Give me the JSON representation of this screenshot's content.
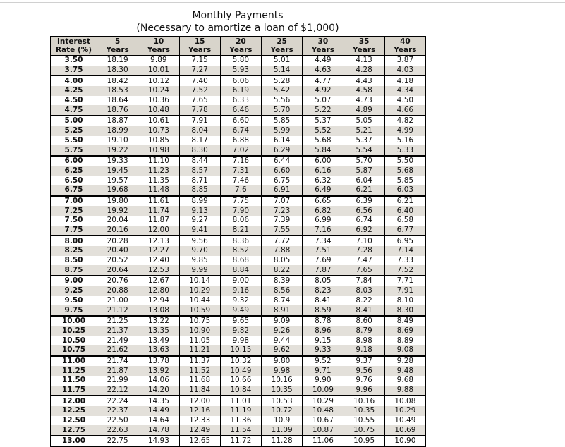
{
  "title": "Monthly Payments",
  "subtitle": "(Necessary to amortize a loan of $1,000)",
  "headers": [
    [
      "Interest",
      "Rate (%)"
    ],
    [
      "5",
      "Years"
    ],
    [
      "10",
      "Years"
    ],
    [
      "15",
      "Years"
    ],
    [
      "20",
      "Years"
    ],
    [
      "25",
      "Years"
    ],
    [
      "30",
      "Years"
    ],
    [
      "35",
      "Years"
    ],
    [
      "40",
      "Years"
    ]
  ],
  "rows": [
    [
      "3.50",
      "18.19",
      "9.89",
      "7.15",
      "5.80",
      "5.01",
      "4.49",
      "4.13",
      "3.87"
    ],
    [
      "3.75",
      "18.30",
      "10.01",
      "7.27",
      "5.93",
      "5.14",
      "4.63",
      "4.28",
      "4.03"
    ],
    [
      "4.00",
      "18.42",
      "10.12",
      "7.40",
      "6.06",
      "5.28",
      "4.77",
      "4.43",
      "4.18"
    ],
    [
      "4.25",
      "18.53",
      "10.24",
      "7.52",
      "6.19",
      "5.42",
      "4.92",
      "4.58",
      "4.34"
    ],
    [
      "4.50",
      "18.64",
      "10.36",
      "7.65",
      "6.33",
      "5.56",
      "5.07",
      "4.73",
      "4.50"
    ],
    [
      "4.75",
      "18.76",
      "10.48",
      "7.78",
      "6.46",
      "5.70",
      "5.22",
      "4.89",
      "4.66"
    ],
    [
      "5.00",
      "18.87",
      "10.61",
      "7.91",
      "6.60",
      "5.85",
      "5.37",
      "5.05",
      "4.82"
    ],
    [
      "5.25",
      "18.99",
      "10.73",
      "8.04",
      "6.74",
      "5.99",
      "5.52",
      "5.21",
      "4.99"
    ],
    [
      "5.50",
      "19.10",
      "10.85",
      "8.17",
      "6.88",
      "6.14",
      "5.68",
      "5.37",
      "5.16"
    ],
    [
      "5.75",
      "19.22",
      "10.98",
      "8.30",
      "7.02",
      "6.29",
      "5.84",
      "5.54",
      "5.33"
    ],
    [
      "6.00",
      "19.33",
      "11.10",
      "8.44",
      "7.16",
      "6.44",
      "6.00",
      "5.70",
      "5.50"
    ],
    [
      "6.25",
      "19.45",
      "11.23",
      "8.57",
      "7.31",
      "6.60",
      "6.16",
      "5.87",
      "5.68"
    ],
    [
      "6.50",
      "19.57",
      "11.35",
      "8.71",
      "7.46",
      "6.75",
      "6.32",
      "6.04",
      "5.85"
    ],
    [
      "6.75",
      "19.68",
      "11.48",
      "8.85",
      "7.6",
      "6.91",
      "6.49",
      "6.21",
      "6.03"
    ],
    [
      "7.00",
      "19.80",
      "11.61",
      "8.99",
      "7.75",
      "7.07",
      "6.65",
      "6.39",
      "6.21"
    ],
    [
      "7.25",
      "19.92",
      "11.74",
      "9.13",
      "7.90",
      "7.23",
      "6.82",
      "6.56",
      "6.40"
    ],
    [
      "7.50",
      "20.04",
      "11.87",
      "9.27",
      "8.06",
      "7.39",
      "6.99",
      "6.74",
      "6.58"
    ],
    [
      "7.75",
      "20.16",
      "12.00",
      "9.41",
      "8.21",
      "7.55",
      "7.16",
      "6.92",
      "6.77"
    ],
    [
      "8.00",
      "20.28",
      "12.13",
      "9.56",
      "8.36",
      "7.72",
      "7.34",
      "7.10",
      "6.95"
    ],
    [
      "8.25",
      "20.40",
      "12.27",
      "9.70",
      "8.52",
      "7.88",
      "7.51",
      "7.28",
      "7.14"
    ],
    [
      "8.50",
      "20.52",
      "12.40",
      "9.85",
      "8.68",
      "8.05",
      "7.69",
      "7.47",
      "7.33"
    ],
    [
      "8.75",
      "20.64",
      "12.53",
      "9.99",
      "8.84",
      "8.22",
      "7.87",
      "7.65",
      "7.52"
    ],
    [
      "9.00",
      "20.76",
      "12.67",
      "10.14",
      "9.00",
      "8.39",
      "8.05",
      "7.84",
      "7.71"
    ],
    [
      "9.25",
      "20.88",
      "12.80",
      "10.29",
      "9.16",
      "8.56",
      "8.23",
      "8.03",
      "7.91"
    ],
    [
      "9.50",
      "21.00",
      "12.94",
      "10.44",
      "9.32",
      "8.74",
      "8.41",
      "8.22",
      "8.10"
    ],
    [
      "9.75",
      "21.12",
      "13.08",
      "10.59",
      "9.49",
      "8.91",
      "8.59",
      "8.41",
      "8.30"
    ],
    [
      "10.00",
      "21.25",
      "13.22",
      "10.75",
      "9.65",
      "9.09",
      "8.78",
      "8.60",
      "8.49"
    ],
    [
      "10.25",
      "21.37",
      "13.35",
      "10.90",
      "9.82",
      "9.26",
      "8.96",
      "8.79",
      "8.69"
    ],
    [
      "10.50",
      "21.49",
      "13.49",
      "11.05",
      "9.98",
      "9.44",
      "9.15",
      "8.98",
      "8.89"
    ],
    [
      "10.75",
      "21.62",
      "13.63",
      "11.21",
      "10.15",
      "9.62",
      "9.33",
      "9.18",
      "9.08"
    ],
    [
      "11.00",
      "21.74",
      "13.78",
      "11.37",
      "10.32",
      "9.80",
      "9.52",
      "9.37",
      "9.28"
    ],
    [
      "11.25",
      "21.87",
      "13.92",
      "11.52",
      "10.49",
      "9.98",
      "9.71",
      "9.56",
      "9.48"
    ],
    [
      "11.50",
      "21.99",
      "14.06",
      "11.68",
      "10.66",
      "10.16",
      "9.90",
      "9.76",
      "9.68"
    ],
    [
      "11.75",
      "22.12",
      "14.20",
      "11.84",
      "10.84",
      "10.35",
      "10.09",
      "9.96",
      "9.88"
    ],
    [
      "12.00",
      "22.24",
      "14.35",
      "12.00",
      "11.01",
      "10.53",
      "10.29",
      "10.16",
      "10.08"
    ],
    [
      "12.25",
      "22.37",
      "14.49",
      "12.16",
      "11.19",
      "10.72",
      "10.48",
      "10.35",
      "10.29"
    ],
    [
      "12.50",
      "22.50",
      "14.64",
      "12.33",
      "11.36",
      "10.9",
      "10.67",
      "10.55",
      "10.49"
    ],
    [
      "12.75",
      "22.63",
      "14.78",
      "12.49",
      "11.54",
      "11.09",
      "10.87",
      "10.75",
      "10.69"
    ],
    [
      "13.00",
      "22.75",
      "14.93",
      "12.65",
      "11.72",
      "11.28",
      "11.06",
      "10.95",
      "10.90"
    ]
  ]
}
